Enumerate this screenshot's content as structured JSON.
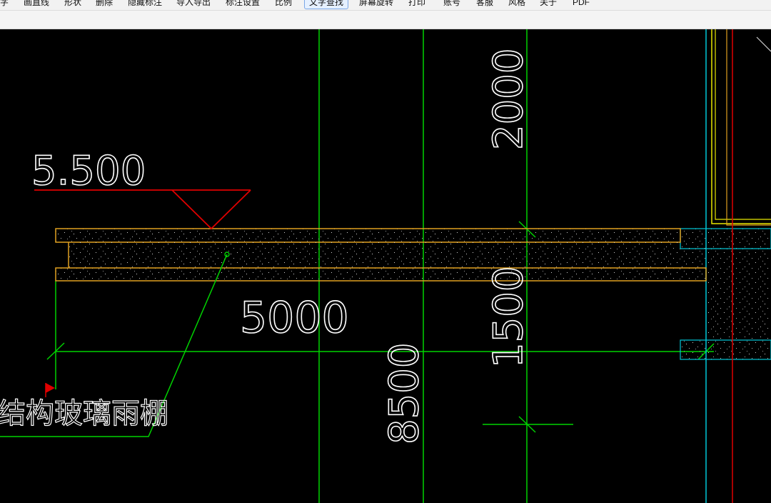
{
  "toolbar": {
    "items": [
      {
        "label": "字"
      },
      {
        "label": "画直线"
      },
      {
        "label": "形状"
      },
      {
        "label": "删除"
      },
      {
        "label": "隐藏标注"
      },
      {
        "label": "导入导出"
      },
      {
        "label": "标注设置"
      },
      {
        "label": "比例"
      },
      {
        "label": "文字查找",
        "active": true
      },
      {
        "label": "屏幕旋转"
      },
      {
        "label": "打印"
      },
      {
        "label": "账号"
      },
      {
        "label": "客服"
      },
      {
        "label": "风格"
      },
      {
        "label": "关于"
      },
      {
        "label": "PDF"
      }
    ]
  },
  "drawing": {
    "elevation_label": "5.500",
    "dim_horizontal": "5000",
    "dim_vertical_top": "2000",
    "dim_vertical_middle": "1500",
    "dim_vertical_bottom": "8500",
    "annotation_text": "结构玻璃雨棚"
  },
  "colors": {
    "background": "#000000",
    "grid_green": "#00d200",
    "slab_orange": "#e0a020",
    "elevation_red": "#e00000",
    "wall_cyan": "#00c8d8",
    "wall_yellow": "#e8e800",
    "text_white": "#ffffff"
  }
}
